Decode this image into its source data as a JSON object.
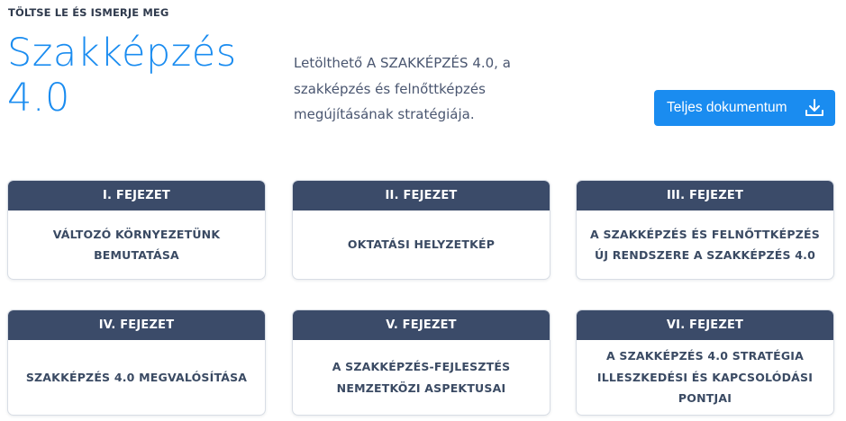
{
  "header": {
    "eyebrow": "TÖLTSE LE ÉS ISMERJE MEG",
    "title": "Szakképzés 4.0",
    "description": "Letölthető A SZAKKÉPZÉS 4.0, a szakképzés és felnőttképzés megújításának stratégiája.",
    "download_label": "Teljes dokumentum",
    "download_icon": "download-icon"
  },
  "colors": {
    "accent": "#1a8cf0",
    "card_header": "#3b4b69",
    "text": "#3a4a63"
  },
  "chapters": [
    {
      "label": "I. FEJEZET",
      "title": "VÁLTOZÓ KÖRNYEZETÜNK BEMUTATÁSA"
    },
    {
      "label": "II. FEJEZET",
      "title": "OKTATÁSI HELYZETKÉP"
    },
    {
      "label": "III. FEJEZET",
      "title": "A SZAKKÉPZÉS ÉS FELNŐTTKÉPZÉS ÚJ RENDSZERE A SZAKKÉPZÉS 4.0"
    },
    {
      "label": "IV. FEJEZET",
      "title": "SZAKKÉPZÉS 4.0 MEGVALÓSÍTÁSA"
    },
    {
      "label": "V. FEJEZET",
      "title": "A SZAKKÉPZÉS-FEJLESZTÉS NEMZETKÖZI ASPEKTUSAI"
    },
    {
      "label": "VI. FEJEZET",
      "title": "A SZAKKÉPZÉS 4.0 STRATÉGIA ILLESZKEDÉSI ÉS KAPCSOLÓDÁSI PONTJAI"
    }
  ]
}
